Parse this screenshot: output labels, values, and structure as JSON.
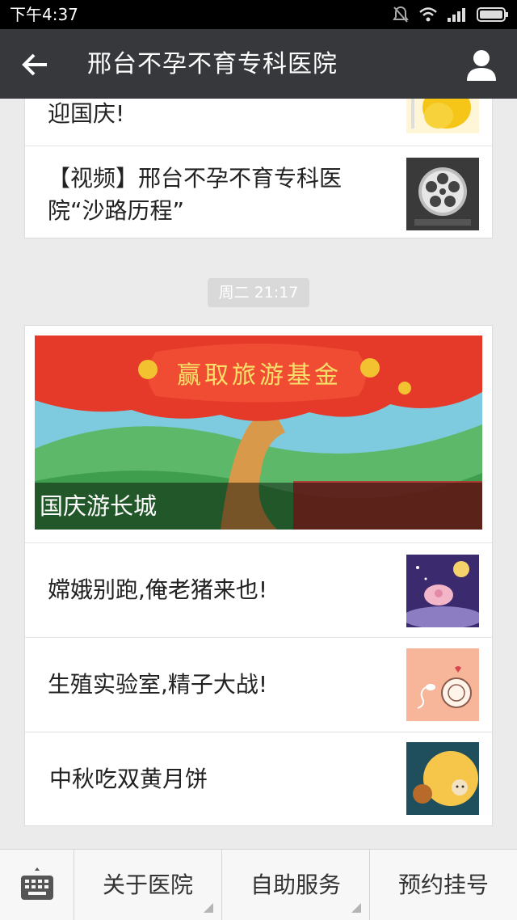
{
  "status_bar": {
    "time": "下午4:37",
    "icons": [
      "mute-icon",
      "wifi-icon",
      "signal-icon",
      "battery-icon"
    ]
  },
  "app_bar": {
    "title": "邢台不孕不育专科医院",
    "back_icon": "back-arrow-icon",
    "profile_icon": "profile-icon"
  },
  "chat": {
    "first_card": {
      "items": [
        {
          "title": "迎国庆!",
          "thumb_icon": "clapping-hands-image"
        },
        {
          "title_line1": "【视频】邢台不孕不育专科医",
          "title_line2": "院“沙路历程”",
          "thumb_icon": "film-reel-image"
        }
      ]
    },
    "timestamp": "周二 21:17",
    "second_card": {
      "banner": {
        "caption": "国庆游长城",
        "banner_text": "赢取旅游基金"
      },
      "items": [
        {
          "title": "嫦娥别跑,俺老猪来也!",
          "thumb_icon": "night-sky-pig-image"
        },
        {
          "title": "生殖实验室,精子大战!",
          "thumb_icon": "sperm-egg-image"
        },
        {
          "title": "中秋吃双黄月饼",
          "thumb_icon": "mooncake-image"
        }
      ]
    }
  },
  "bottom_menu": {
    "keyboard_icon": "keyboard-icon",
    "items": [
      "关于医院",
      "自助服务",
      "预约挂号"
    ]
  },
  "colors": {
    "status_bar_bg": "#000000",
    "app_bar_bg": "#36383c",
    "chat_bg": "#ebebeb",
    "timestamp_bg": "#d9d9d9"
  }
}
